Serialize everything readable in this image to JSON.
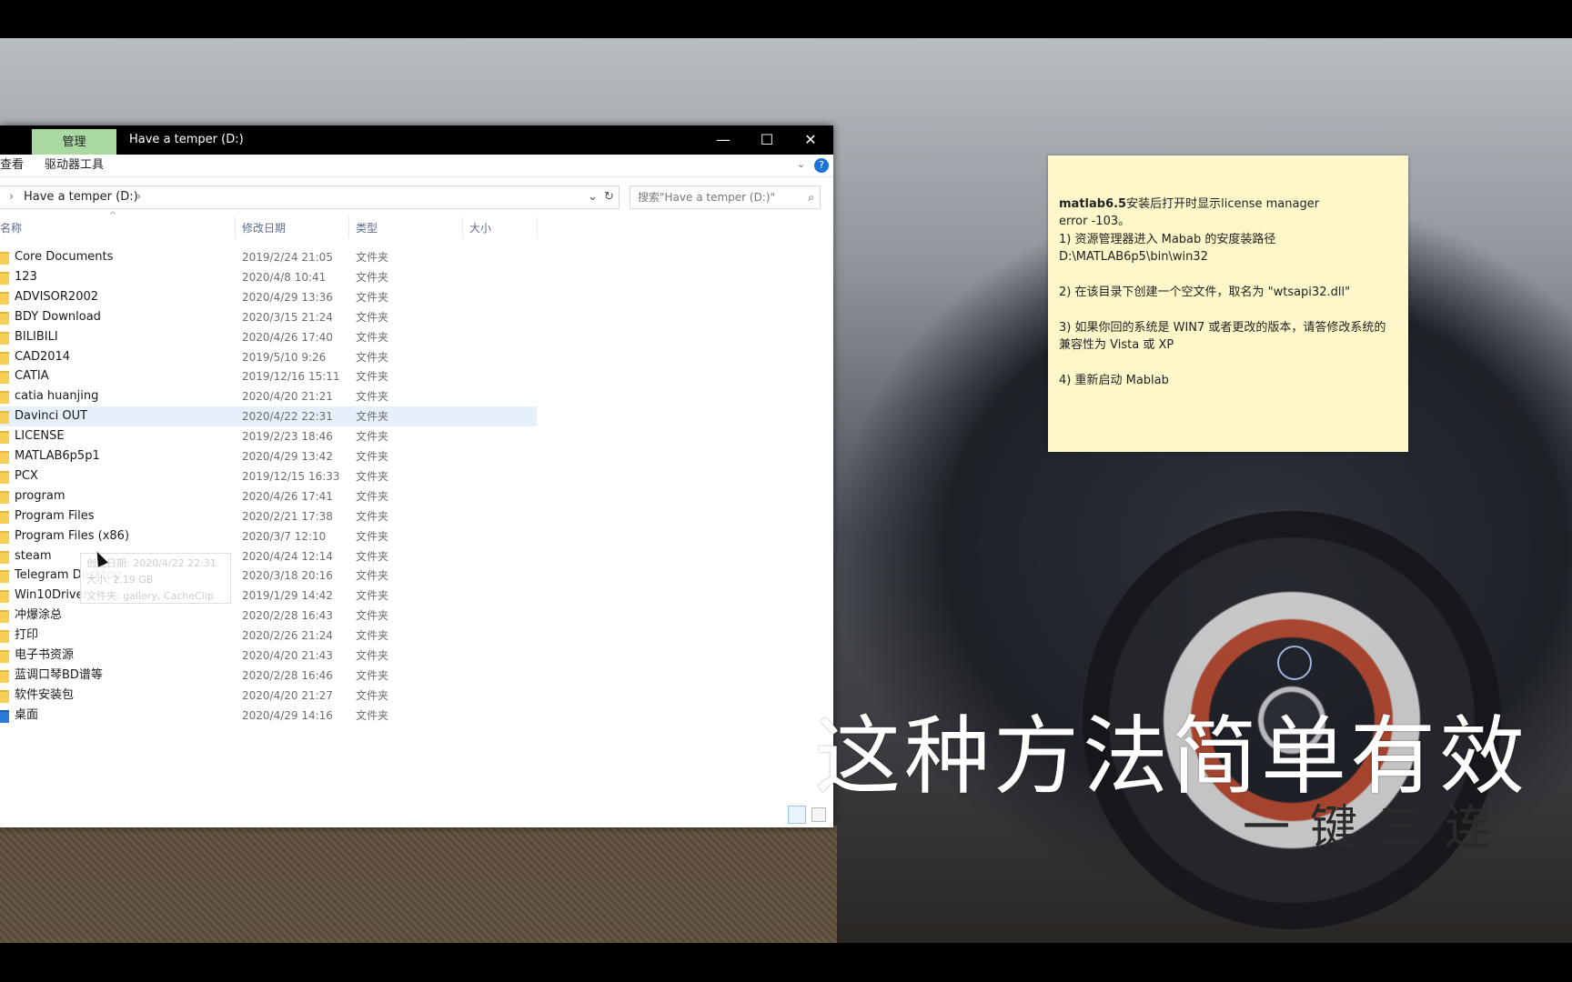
{
  "window": {
    "tab_manage": "管理",
    "title": "Have a temper (D:)",
    "ribbon_view": "查看",
    "ribbon_drive_tools": "驱动器工具",
    "address_path": "Have a temper (D:)",
    "search_placeholder": "搜索\"Have a temper (D:)\"",
    "columns": {
      "name": "名称",
      "date": "修改日期",
      "type": "类型",
      "size": "大小"
    }
  },
  "files": [
    {
      "name": "Core Documents",
      "date": "2019/2/24 21:05",
      "type": "文件夹"
    },
    {
      "name": "123",
      "date": "2020/4/8 10:41",
      "type": "文件夹"
    },
    {
      "name": "ADVISOR2002",
      "date": "2020/4/29 13:36",
      "type": "文件夹"
    },
    {
      "name": "BDY Download",
      "date": "2020/3/15 21:24",
      "type": "文件夹"
    },
    {
      "name": "BILIBILI",
      "date": "2020/4/26 17:40",
      "type": "文件夹"
    },
    {
      "name": "CAD2014",
      "date": "2019/5/10 9:26",
      "type": "文件夹"
    },
    {
      "name": "CATIA",
      "date": "2019/12/16 15:11",
      "type": "文件夹"
    },
    {
      "name": "catia huanjing",
      "date": "2020/4/20 21:21",
      "type": "文件夹"
    },
    {
      "name": "Davinci OUT",
      "date": "2020/4/22 22:31",
      "type": "文件夹"
    },
    {
      "name": "LICENSE",
      "date": "2019/2/23 18:46",
      "type": "文件夹"
    },
    {
      "name": "MATLAB6p5p1",
      "date": "2020/4/29 13:42",
      "type": "文件夹"
    },
    {
      "name": "PCX",
      "date": "2019/12/15 16:33",
      "type": "文件夹"
    },
    {
      "name": "program",
      "date": "2020/4/26 17:41",
      "type": "文件夹"
    },
    {
      "name": "Program Files",
      "date": "2020/2/21 17:38",
      "type": "文件夹"
    },
    {
      "name": "Program Files (x86)",
      "date": "2020/3/7 12:10",
      "type": "文件夹"
    },
    {
      "name": "steam",
      "date": "2020/4/24 12:14",
      "type": "文件夹"
    },
    {
      "name": "Telegram Desktop",
      "date": "2020/3/18 20:16",
      "type": "文件夹"
    },
    {
      "name": "Win10Driver",
      "date": "2019/1/29 14:42",
      "type": "文件夹"
    },
    {
      "name": "冲爆涂总",
      "date": "2020/2/28 16:43",
      "type": "文件夹"
    },
    {
      "name": "打印",
      "date": "2020/2/26 21:24",
      "type": "文件夹"
    },
    {
      "name": "电子书资源",
      "date": "2020/4/20 21:43",
      "type": "文件夹"
    },
    {
      "name": "蓝调口琴BD谱等",
      "date": "2020/2/28 16:46",
      "type": "文件夹"
    },
    {
      "name": "软件安装包",
      "date": "2020/4/20 21:27",
      "type": "文件夹"
    },
    {
      "name": "桌面",
      "date": "2020/4/29 14:16",
      "type": "文件夹"
    }
  ],
  "selected_row": "Davinci OUT",
  "tooltip": {
    "line1": "创建日期: 2020/4/22 22:31",
    "line2": "大小: 2.19 GB",
    "line3": "文件夹: gallery, CacheClip"
  },
  "note": {
    "title_bold": "matlab6.5",
    "title_rest": "安装后打开时显示license manager",
    "line2": "error -103。",
    "step1": "1) 资源管理器进入 Mabab 的安度装路径 D:\\MATLAB6p5\\bin\\win32",
    "step2": "2) 在该目录下创建一个空文件，取名为 \"wtsapi32.dll\"",
    "step3": "3) 如果你回的系统是 WIN7 或者更改的版本，请答修改系统的兼容性为 Vista 或 XP",
    "step4": "4) 重新启动 Mablab"
  },
  "overlay": {
    "caption": "这种方法简单有效",
    "subcaption": "一键三连"
  },
  "colors": {
    "manage_tab": "#a9d8a0",
    "selection": "#e5f0fb",
    "note_bg": "#fdf7c9"
  }
}
